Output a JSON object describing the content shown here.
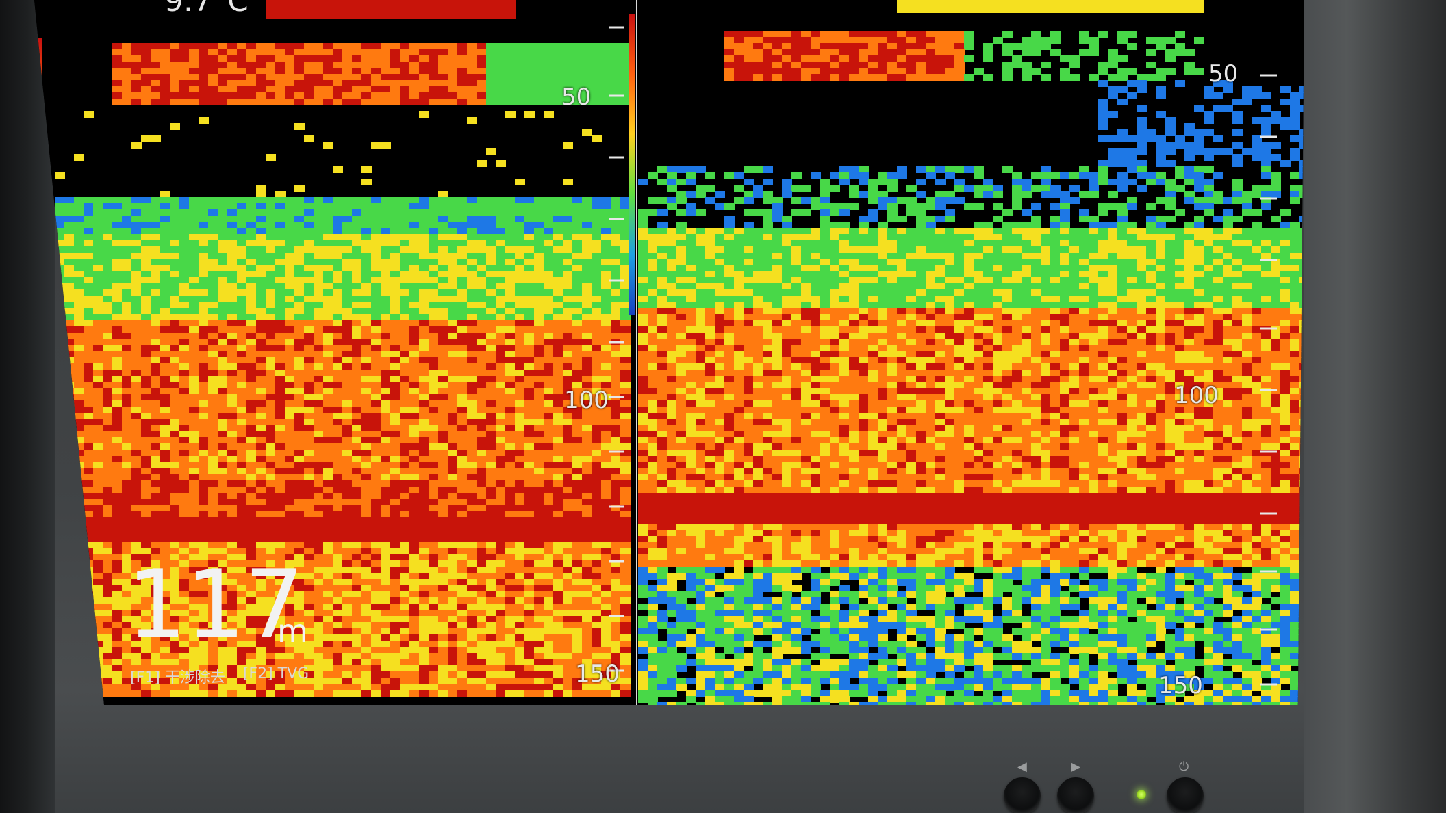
{
  "display": {
    "temperature": "9.7°C",
    "current_depth": "117",
    "current_depth_unit": "m",
    "function_keys": [
      {
        "key": "[F1]",
        "label": "干涉除去"
      },
      {
        "key": "[F2]",
        "label": "TVG"
      }
    ]
  },
  "left_pane": {
    "depth_scale": [
      "50",
      "100",
      "150"
    ]
  },
  "right_pane": {
    "depth_scale": [
      "50",
      "100",
      "150"
    ]
  },
  "colors": {
    "strong_echo": "#c8140a",
    "medium_echo": "#ff7a10",
    "weak_echo": "#f5e020",
    "faint_echo": "#48d848",
    "trace_echo": "#1e78e6",
    "background": "#000000",
    "bottom_band": "#b80c08"
  },
  "icons": {
    "left_button": "triangle-left-icon",
    "right_button": "triangle-right-icon",
    "power_button": "power-icon"
  }
}
